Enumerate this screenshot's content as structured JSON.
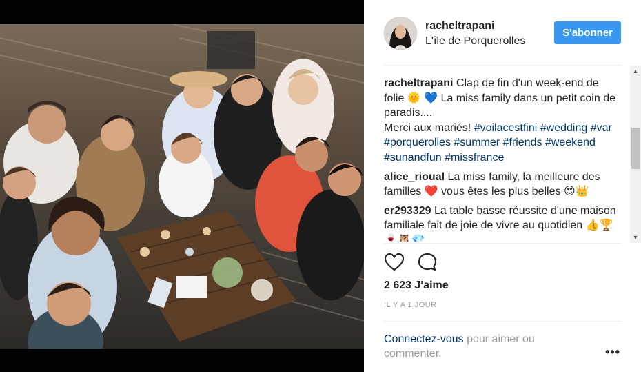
{
  "post": {
    "username": "racheltrapani",
    "location": "L'île de Porquerolles",
    "follow_label": "S'abonner",
    "likes": "2 623 J'aime",
    "time_ago": "IL Y A 1 JOUR",
    "login_link": "Connectez-vous",
    "login_text": " pour aimer ou commenter.",
    "more_label": "•••"
  },
  "caption": {
    "user": "racheltrapani",
    "text1": " Clap de fin d'un week-end de folie ",
    "emoji1": "🌞",
    "emoji2": "💙",
    "text2": " La miss family dans un petit coin de paradis....",
    "text3": "Merci aux mariés! ",
    "tags": [
      "#voilacestfini",
      "#wedding",
      "#var",
      "#porquerolles",
      "#summer",
      "#friends",
      "#weekend",
      "#sunandfun",
      "#missfrance"
    ]
  },
  "comments": [
    {
      "user": "alice_rioual",
      "text": " La miss family, la meilleure des familles ",
      "emoji": "❤️",
      "text_b": " vous êtes les plus belles ",
      "emoji_b": "😍👑"
    },
    {
      "user": "er293329",
      "text": " La table basse réussite d'une maison familiale fait de joie de vivre au quotidien ",
      "emoji": "👍🏆🍷🦉💎"
    }
  ],
  "icons": {
    "like": "heart-icon",
    "comment": "comment-bubble-icon",
    "avatar": "profile-avatar"
  },
  "colors": {
    "accent": "#3897f0",
    "link": "#003569",
    "muted": "#999999"
  }
}
